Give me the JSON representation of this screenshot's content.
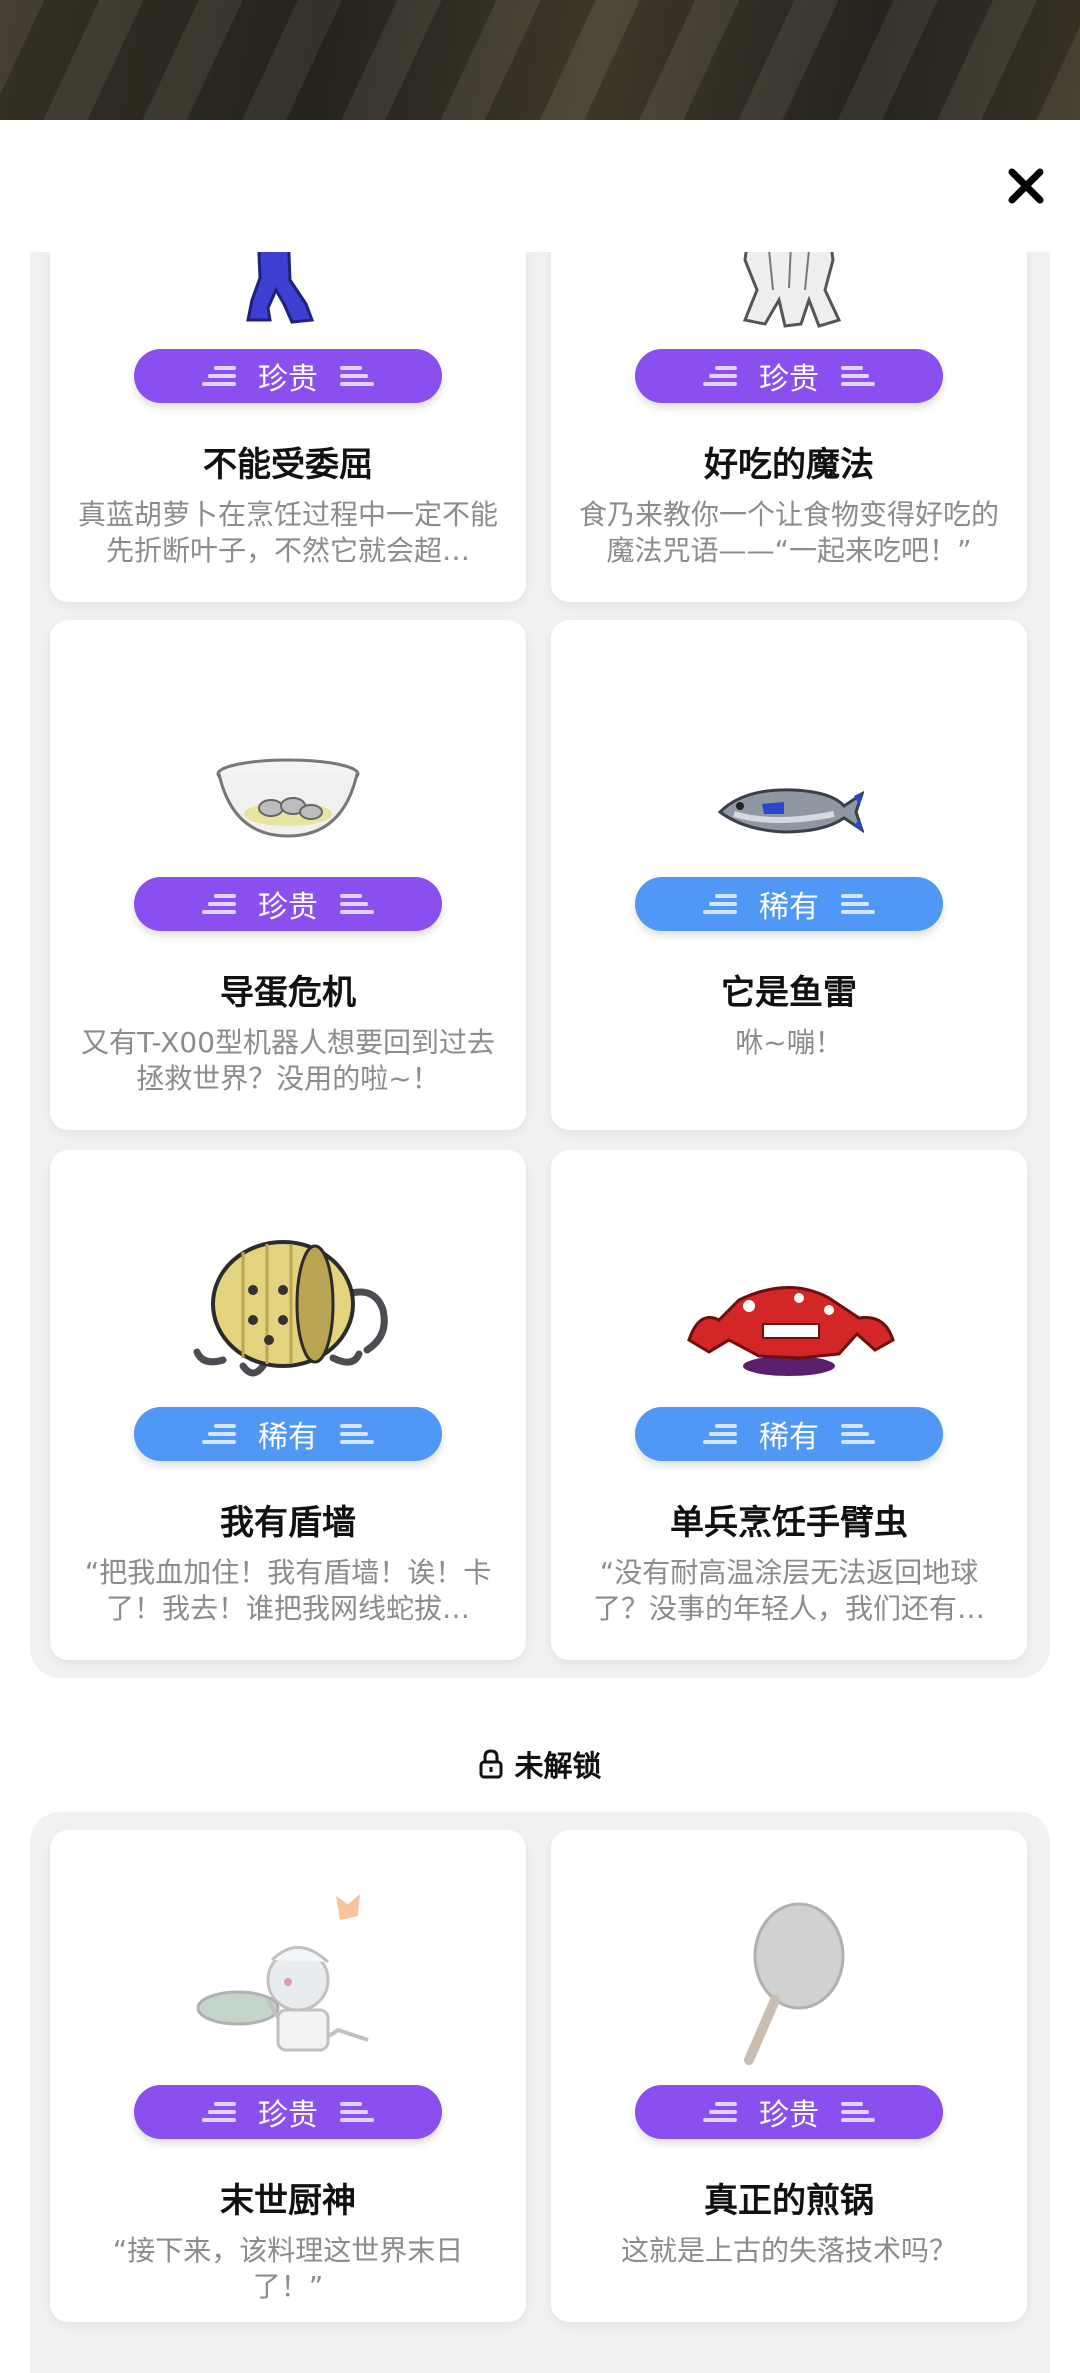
{
  "header": {
    "close_icon": "close-icon"
  },
  "colors": {
    "rare": "#5197f5",
    "precious": "#8b4ff0",
    "panel": "#f1f1f1"
  },
  "unlocked_cards": [
    {
      "title": "不能受委屈",
      "rarity": "珍贵",
      "description": "真蓝胡萝卜在烹饪过程中一定不能先折断叶子，不然它就会超…",
      "art": "blue-carrot-legs"
    },
    {
      "title": "好吃的魔法",
      "rarity": "珍贵",
      "description": "食乃来教你一个让食物变得好吃的魔法咒语——“一起来吃吧！”",
      "art": "white-tentacle-creature"
    },
    {
      "title": "导蛋危机",
      "rarity": "珍贵",
      "description": "又有T-X00型机器人想要回到过去拯救世界？没用的啦~！",
      "art": "glass-bowl-eggs"
    },
    {
      "title": "它是鱼雷",
      "rarity": "稀有",
      "description": "咻~嘣！",
      "art": "tuna-fish"
    },
    {
      "title": "我有盾墙",
      "rarity": "稀有",
      "description": "“把我血加住！我有盾墙！诶！卡了！我去！谁把我网线蛇拔…",
      "art": "wooden-shield-creature"
    },
    {
      "title": "单兵烹饪手臂虫",
      "rarity": "稀有",
      "description": "“没有耐高温涂层无法返回地球了？没事的年轻人，我们还有…",
      "art": "red-crab-monster"
    }
  ],
  "locked_section": {
    "label": "未解锁",
    "icon": "lock-icon"
  },
  "locked_cards": [
    {
      "title": "末世厨神",
      "rarity": "珍贵",
      "description": "“接下来，该料理这世界末日了！”",
      "art": "chef-character"
    },
    {
      "title": "真正的煎锅",
      "rarity": "珍贵",
      "description": "这就是上古的失落技术吗？",
      "art": "racket-pan"
    }
  ]
}
